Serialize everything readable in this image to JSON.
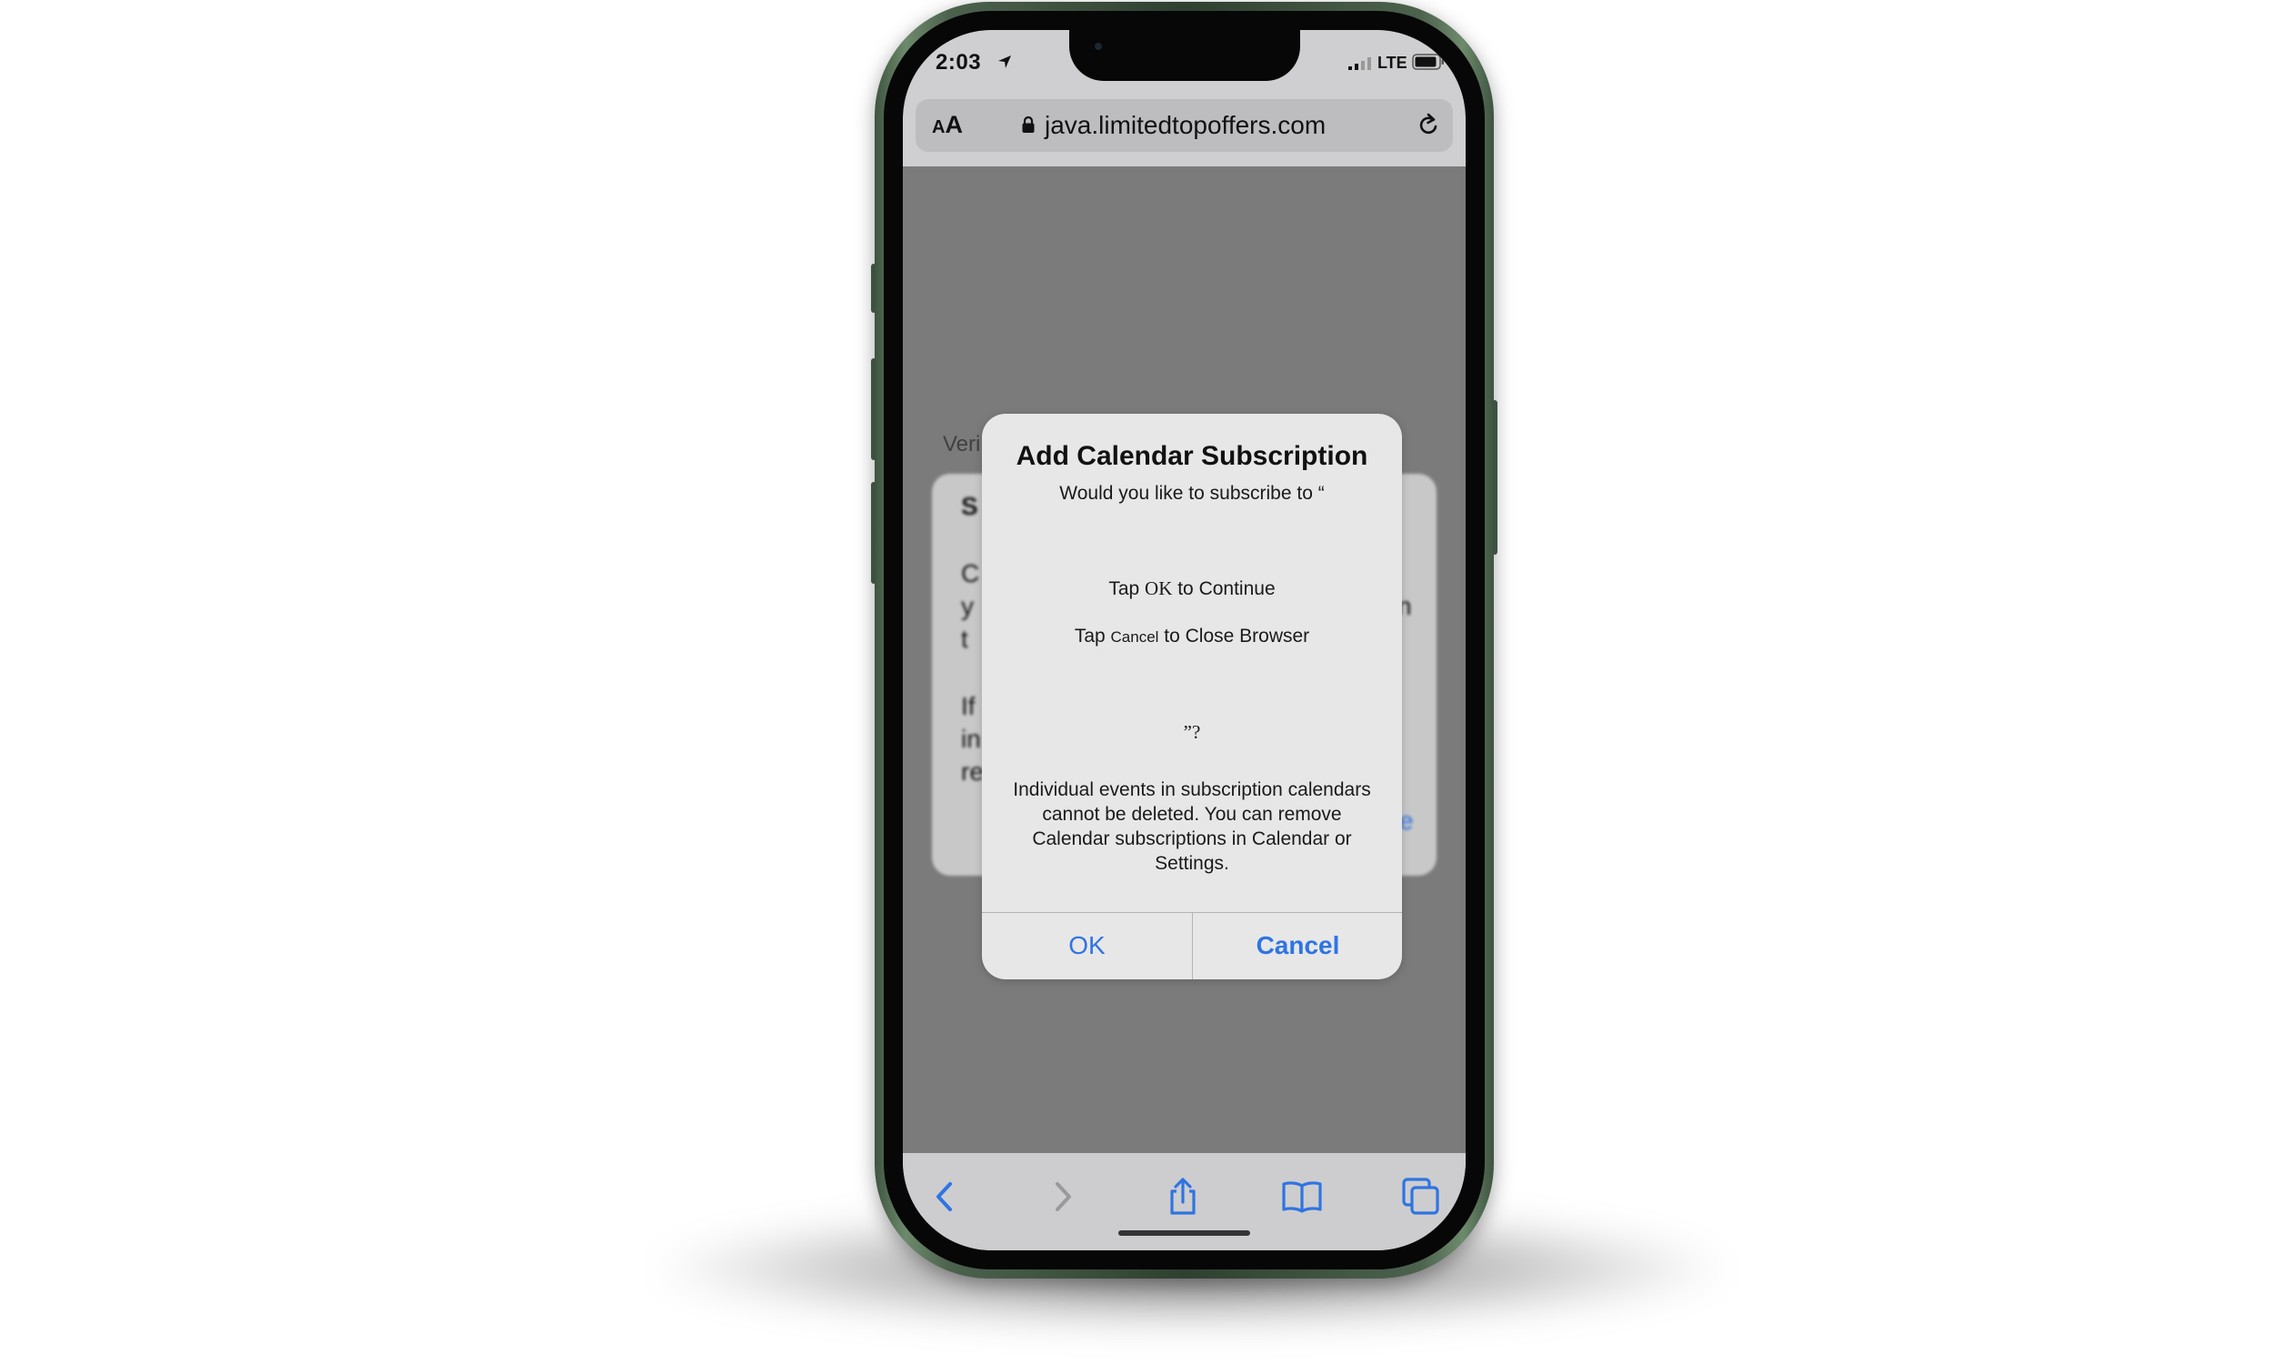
{
  "status_bar": {
    "time": "2:03",
    "carrier": "LTE"
  },
  "address_bar": {
    "text_size_label_small": "A",
    "text_size_label_large": "A",
    "url": "java.limitedtopoffers.com"
  },
  "background_page": {
    "header_fragment": "Veri",
    "dialog_left_fragments": [
      "S",
      "C",
      "y",
      "t",
      "If",
      "in",
      "re"
    ],
    "dialog_right_fragments": [
      "n",
      "se"
    ]
  },
  "alert": {
    "title": "Add Calendar Subscription",
    "subtitle": "Would you like to subscribe to “",
    "line1": {
      "prefix": "Tap ",
      "key": "OK",
      "suffix": " to Continue"
    },
    "line2": {
      "prefix": "Tap ",
      "key": "Cancel",
      "suffix": " to Close Browser"
    },
    "closing": "”?",
    "note": "Individual events in subscription calendars cannot be deleted. You can remove Calendar subscriptions in Calendar or Settings.",
    "ok_label": "OK",
    "cancel_label": "Cancel"
  },
  "toolbar": {
    "icons": [
      "back-icon",
      "forward-icon",
      "share-icon",
      "bookmarks-icon",
      "tabs-icon"
    ]
  },
  "colors": {
    "accent": "#2f74e2",
    "phone_frame": "#4c624d",
    "overlay": "#7b7b7b"
  }
}
